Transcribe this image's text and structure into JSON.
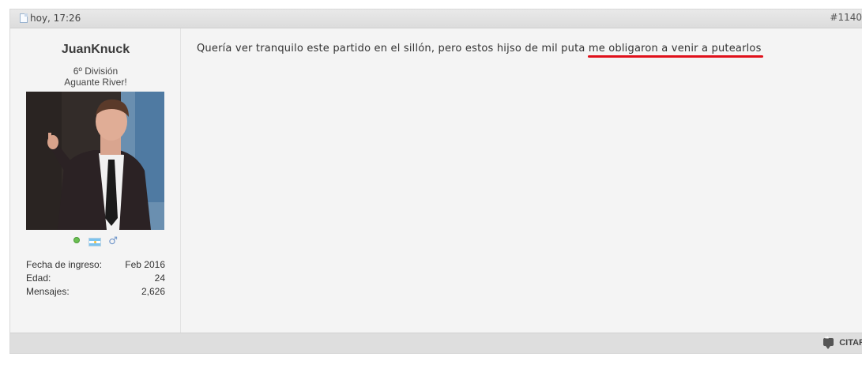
{
  "post": {
    "date": "hoy, 17:26",
    "number": "#1140",
    "user": {
      "name": "JuanKnuck",
      "title_line1": "6º División",
      "title_line2": "Aguante River!",
      "stats": [
        {
          "label": "Fecha de ingreso:",
          "value": "Feb 2016"
        },
        {
          "label": "Edad:",
          "value": "24"
        },
        {
          "label": "Mensajes:",
          "value": "2,626"
        }
      ]
    },
    "message_plain": "Quería ver tranquilo este partido en el sillón, pero estos hijso de mil puta ",
    "message_underlined": "me obligaron a venir a putearlos",
    "quote_label": "CITAR"
  },
  "colors": {
    "underline": "#e0101a",
    "header_bg": "#e3e3e3",
    "body_bg": "#f4f4f4"
  }
}
